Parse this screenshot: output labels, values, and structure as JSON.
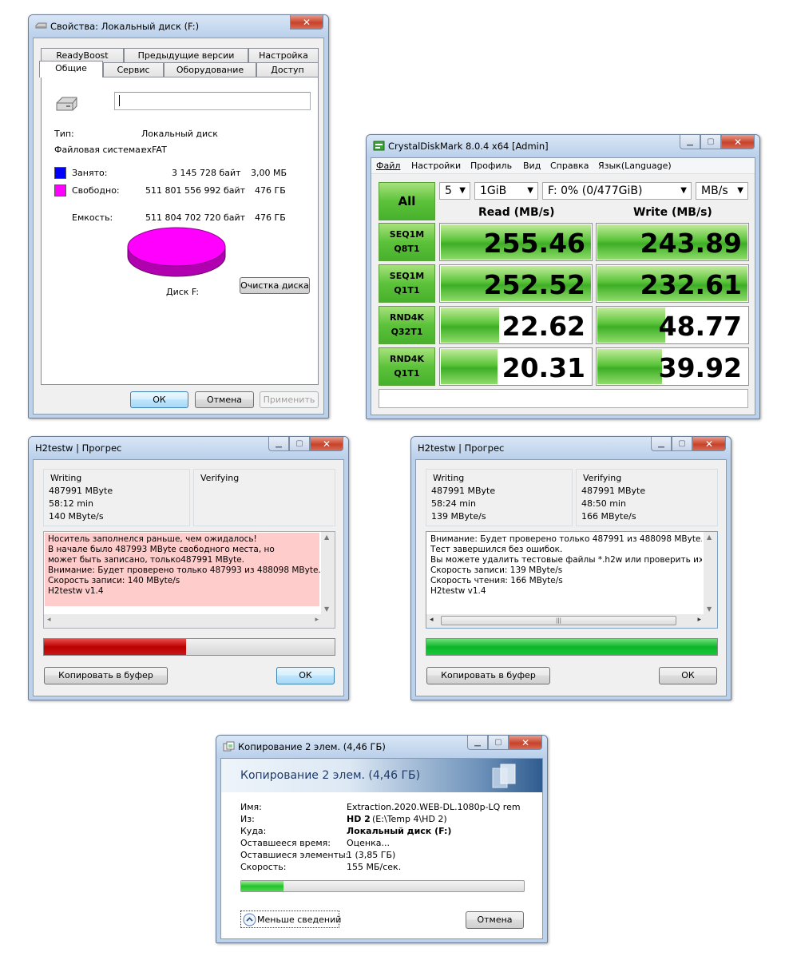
{
  "props": {
    "title": "Свойства: Локальный диск (F:)",
    "tabs_row1": [
      "ReadyBoost",
      "Предыдущие версии",
      "Настройка"
    ],
    "tabs_row2": [
      "Общие",
      "Сервис",
      "Оборудование",
      "Доступ"
    ],
    "type_label": "Тип:",
    "type_value": "Локальный диск",
    "fs_label": "Файловая система:",
    "fs_value": "exFAT",
    "used_label": "Занято:",
    "used_bytes": "3 145 728 байт",
    "used_size": "3,00 МБ",
    "free_label": "Свободно:",
    "free_bytes": "511 801 556 992 байт",
    "free_size": "476 ГБ",
    "cap_label": "Емкость:",
    "cap_bytes": "511 804 702 720 байт",
    "cap_size": "476 ГБ",
    "disk_label": "Диск F:",
    "cleanup_button": "Очистка диска",
    "ok": "ОК",
    "cancel": "Отмена",
    "apply": "Применить",
    "used_color": "#0000ff",
    "free_color": "#ff00ff"
  },
  "cdm": {
    "title": "CrystalDiskMark 8.0.4 x64 [Admin]",
    "menu": [
      "Файл",
      "Настройки",
      "Профиль",
      "Вид",
      "Справка",
      "Язык(Language)"
    ],
    "all_button": "All",
    "count": "5",
    "size": "1GiB",
    "drive": "F: 0% (0/477GiB)",
    "unit": "MB/s",
    "read_header": "Read (MB/s)",
    "write_header": "Write (MB/s)",
    "rows": [
      {
        "l1": "SEQ1M",
        "l2": "Q8T1",
        "read": "255.46",
        "write": "243.89",
        "read_frac": 1.0,
        "write_frac": 1.0
      },
      {
        "l1": "SEQ1M",
        "l2": "Q1T1",
        "read": "252.52",
        "write": "232.61",
        "read_frac": 1.0,
        "write_frac": 1.0
      },
      {
        "l1": "RND4K",
        "l2": "Q32T1",
        "read": "22.62",
        "write": "48.77",
        "read_frac": 0.39,
        "write_frac": 0.45
      },
      {
        "l1": "RND4K",
        "l2": "Q1T1",
        "read": "20.31",
        "write": "39.92",
        "read_frac": 0.38,
        "write_frac": 0.43
      }
    ]
  },
  "h2a": {
    "title": "H2testw | Прогрес",
    "writing": "Writing",
    "w1": "487991 MByte",
    "w2": "58:12 min",
    "w3": "140 MByte/s",
    "verifying": "Verifying",
    "log": "Носитель заполнелся раньше, чем ожидалось!\nВ начале было 487993 MByte свободного места, но\nможет быть записано, только487991 MByte.\nВнимание: Будет проверено только 487993 из 488098 MByte.\nСкорость записи: 140 MByte/s\nH2testw v1.4",
    "progress": 0.49,
    "copy": "Копировать в буфер",
    "ok": "ОК"
  },
  "h2b": {
    "title": "H2testw | Прогрес",
    "writing": "Writing",
    "w1": "487991 MByte",
    "w2": "58:24 min",
    "w3": "139 MByte/s",
    "verifying": "Verifying",
    "v1": "487991 MByte",
    "v2": "48:50 min",
    "v3": "166 MByte/s",
    "log": "Внимание: Будет проверено только 487991 из 488098 MByte.\nТест завершился без ошибок.\nВы можете удалить тестовые файлы *.h2w или проверить их сног\nСкорость записи: 139 MByte/s\nСкорость чтения: 166 MByte/s\nH2testw v1.4",
    "progress": 1.0,
    "copy": "Копировать в буфер",
    "ok": "ОК"
  },
  "copy": {
    "title": "Копирование 2 элем. (4,46 ГБ)",
    "banner": "Копирование 2 элем. (4,46 ГБ)",
    "name_l": "Имя:",
    "name_v": "Extraction.2020.WEB-DL.1080p-LQ rem",
    "from_l": "Из:",
    "from_v": "HD 2",
    "from_v2": "(E:\\Temp 4\\HD 2)",
    "to_l": "Куда:",
    "to_v": "Локальный диск (F:)",
    "time_l": "Оставшееся время:",
    "time_v": "Оценка...",
    "items_l": "Оставшиеся элементы:",
    "items_v": "1 (3,85 ГБ)",
    "speed_l": "Скорость:",
    "speed_v": "155 МБ/сек.",
    "progress": 0.15,
    "less": "Меньше сведений",
    "cancel": "Отмена"
  }
}
